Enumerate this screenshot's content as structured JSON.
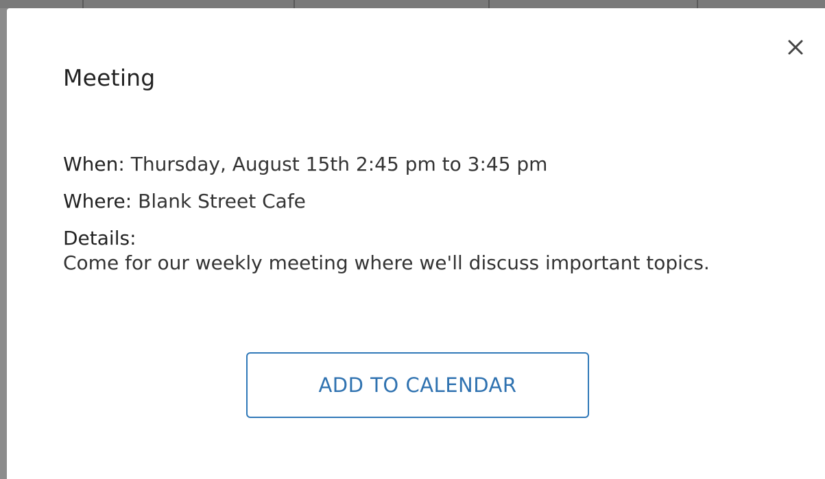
{
  "modal": {
    "title": "Meeting",
    "close_icon": "close-icon",
    "when_label": "When:",
    "when_value": "Thursday, August 15th 2:45 pm to 3:45 pm",
    "where_label": "Where:",
    "where_value": "Blank Street Cafe",
    "details_label": "Details:",
    "details_text": "Come for our weekly meeting where we'll discuss important topics.",
    "add_button_label": "ADD TO CALENDAR"
  },
  "colors": {
    "accent": "#2f78b8",
    "backdrop": "#8c8c8c",
    "text": "#333333"
  }
}
